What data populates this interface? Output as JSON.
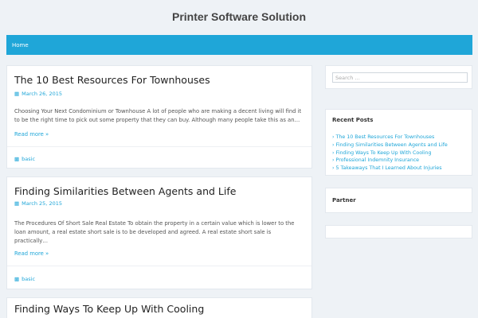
{
  "header": {
    "site_title": "Printer Software Solution"
  },
  "nav": {
    "items": [
      {
        "label": "Home"
      }
    ]
  },
  "posts": [
    {
      "title": "The 10 Best Resources For Townhouses",
      "date": "March 26, 2015",
      "excerpt": "Choosing Your Next Condominium or Townhouse A lot of people who are making a decent living will find it to be the right time to pick out some property that they can buy. Although many people take this as an…",
      "read_more": "Read more »",
      "category": "basic"
    },
    {
      "title": "Finding Similarities Between Agents and Life",
      "date": "March 25, 2015",
      "excerpt": "The Procedures Of Short Sale Real Estate To obtain the property in a certain value which is lower to the loan amount, a real estate short sale is to be developed and agreed. A real estate short sale is practically…",
      "read_more": "Read more »",
      "category": "basic"
    },
    {
      "title": "Finding Ways To Keep Up With Cooling"
    }
  ],
  "sidebar": {
    "search": {
      "placeholder": "Search …"
    },
    "recent_posts": {
      "title": "Recent Posts",
      "items": [
        "The 10 Best Resources For Townhouses",
        "Finding Similarities Between Agents and Life",
        "Finding Ways To Keep Up With Cooling",
        "Professional Indemnity Insurance",
        "5 Takeaways That I Learned About Injuries"
      ]
    },
    "partner": {
      "title": "Partner"
    }
  },
  "colors": {
    "accent": "#1fa6d8",
    "background": "#eef2f6"
  },
  "icons": {
    "date": "calendar-icon",
    "category": "folder-icon",
    "list": "chevron-right-icon"
  }
}
